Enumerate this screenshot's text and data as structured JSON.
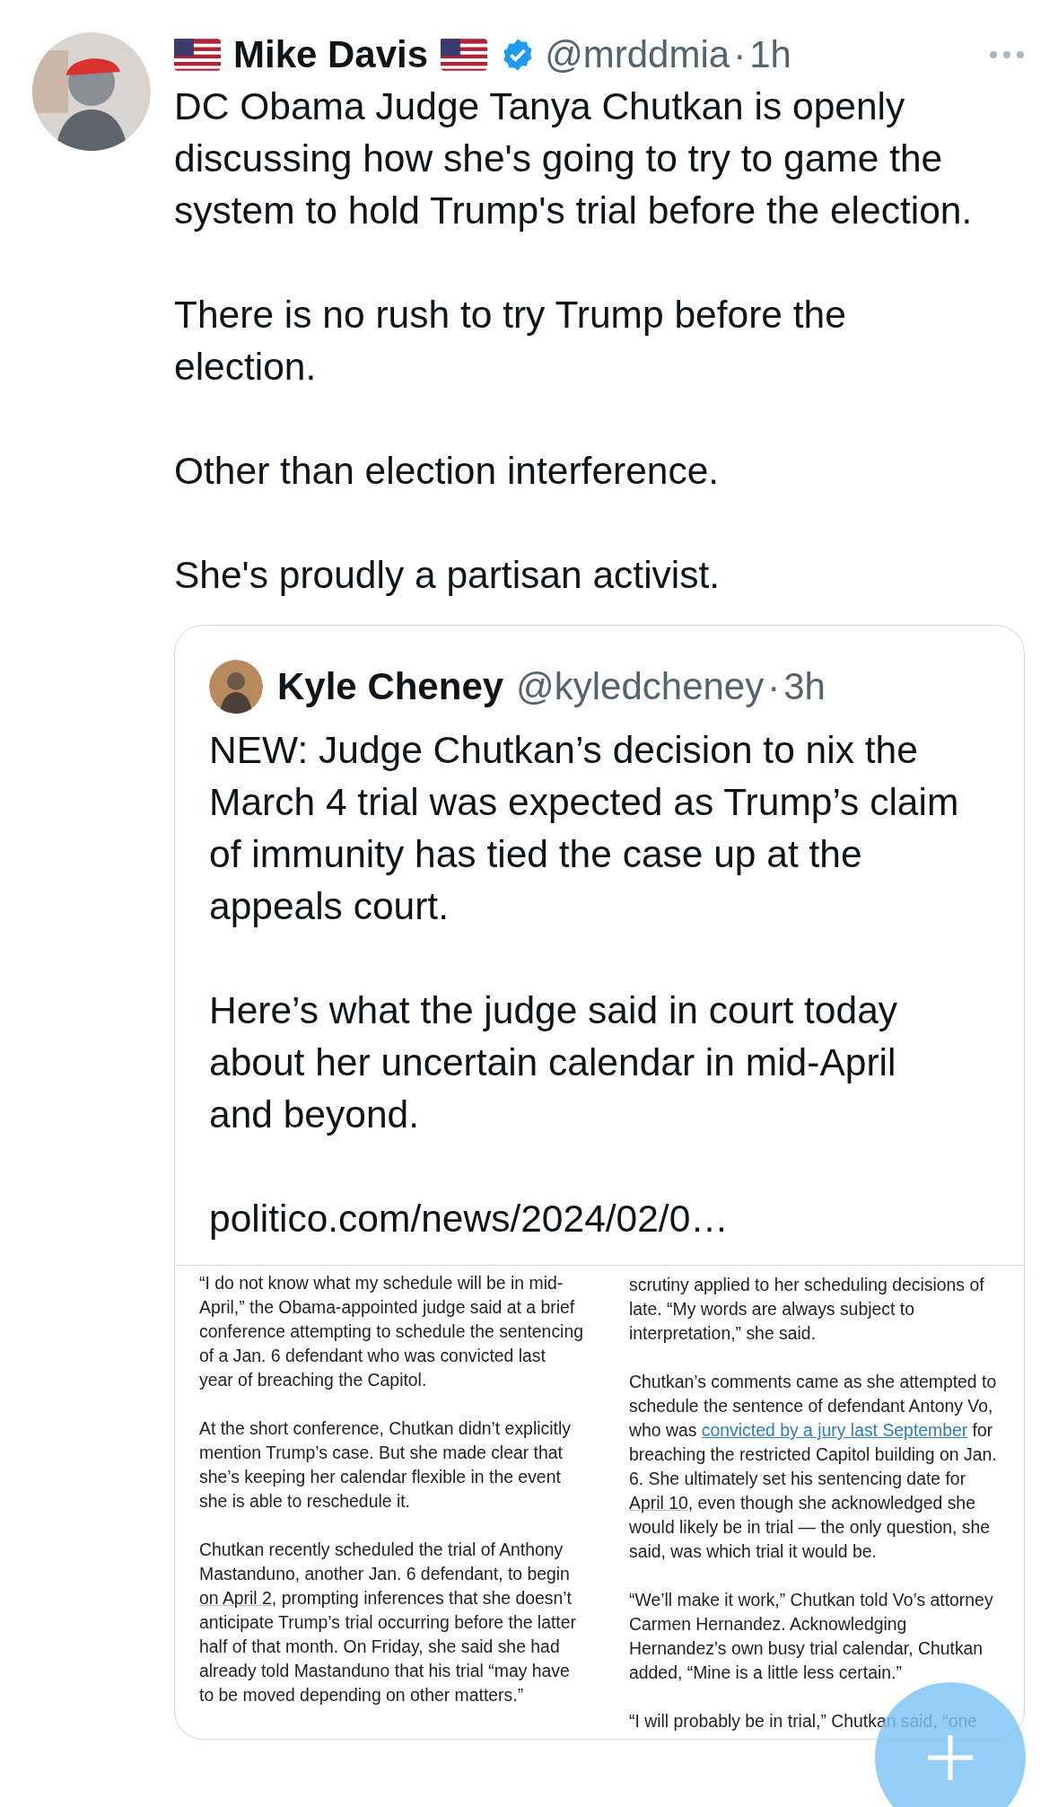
{
  "tweet": {
    "author_name": "Mike Davis",
    "verified": true,
    "handle": "@mrddmia",
    "separator": "·",
    "time": "1h",
    "paragraphs": [
      "DC Obama Judge Tanya Chutkan is openly discussing how she's going to try to game the system to hold Trump's trial before the election.",
      "There is no rush to try Trump before the election.",
      "Other than election interference.",
      "She's proudly a partisan activist."
    ]
  },
  "quoted_tweet": {
    "author_name": "Kyle Cheney",
    "handle": "@kyledcheney",
    "separator": "·",
    "time": "3h",
    "paragraphs": [
      "NEW: Judge Chutkan’s decision to nix the March 4 trial was expected as Trump’s claim of immunity has tied the case up at the appeals court.",
      "Here’s what the judge said in court today about her uncertain calendar in mid-April and beyond."
    ],
    "link": "politico.com/news/2024/02/0…",
    "article_image": {
      "columns": [
        {
          "paragraphs": [
            [
              {
                "kind": "text",
                "text": "“I do not know what my schedule will be in mid-April,” the Obama-appointed judge said at a brief conference attempting to schedule the sentencing of a Jan. 6 defendant who was convicted last year of breaching the Capitol."
              }
            ],
            [
              {
                "kind": "text",
                "text": "At the short conference, Chutkan didn’t explicitly mention Trump’s case. But she made clear that she’s keeping her calendar flexible in the event she is able to reschedule it."
              }
            ],
            [
              {
                "kind": "text",
                "text": "Chutkan recently scheduled the trial of Anthony Mastanduno, another Jan. 6 defendant, to begin "
              },
              {
                "kind": "underline",
                "text": "on April 2"
              },
              {
                "kind": "text",
                "text": ", prompting inferences that she doesn’t anticipate Trump’s trial occurring before the latter half of that month. On Friday, she said she had already told Mastanduno that his trial “may have to be moved depending on other matters.”"
              }
            ]
          ]
        },
        {
          "paragraphs": [
            [
              {
                "kind": "text",
                "text": "scrutiny applied to her scheduling decisions of late. “My words are always subject to interpretation,” she said."
              }
            ],
            [
              {
                "kind": "text",
                "text": "Chutkan’s comments came as she attempted to schedule the sentence of defendant Antony Vo, who was "
              },
              {
                "kind": "link",
                "text": "convicted by a jury last September"
              },
              {
                "kind": "text",
                "text": " for breaching the restricted Capitol building on Jan. 6. She ultimately set his sentencing date for "
              },
              {
                "kind": "underline",
                "text": "April 10"
              },
              {
                "kind": "text",
                "text": ", even though she acknowledged she would likely be in trial — the only question, she said, was which trial it would be."
              }
            ],
            [
              {
                "kind": "text",
                "text": "“We’ll make it work,” Chutkan told Vo’s attorney Carmen Hernandez. Acknowledging Hernandez’s own busy trial calendar, Chutkan added, “Mine is a little less certain.”"
              }
            ],
            [
              {
                "kind": "text",
                "text": "“I will probably be in trial,” Chutkan said, “one"
              }
            ]
          ]
        }
      ]
    }
  }
}
